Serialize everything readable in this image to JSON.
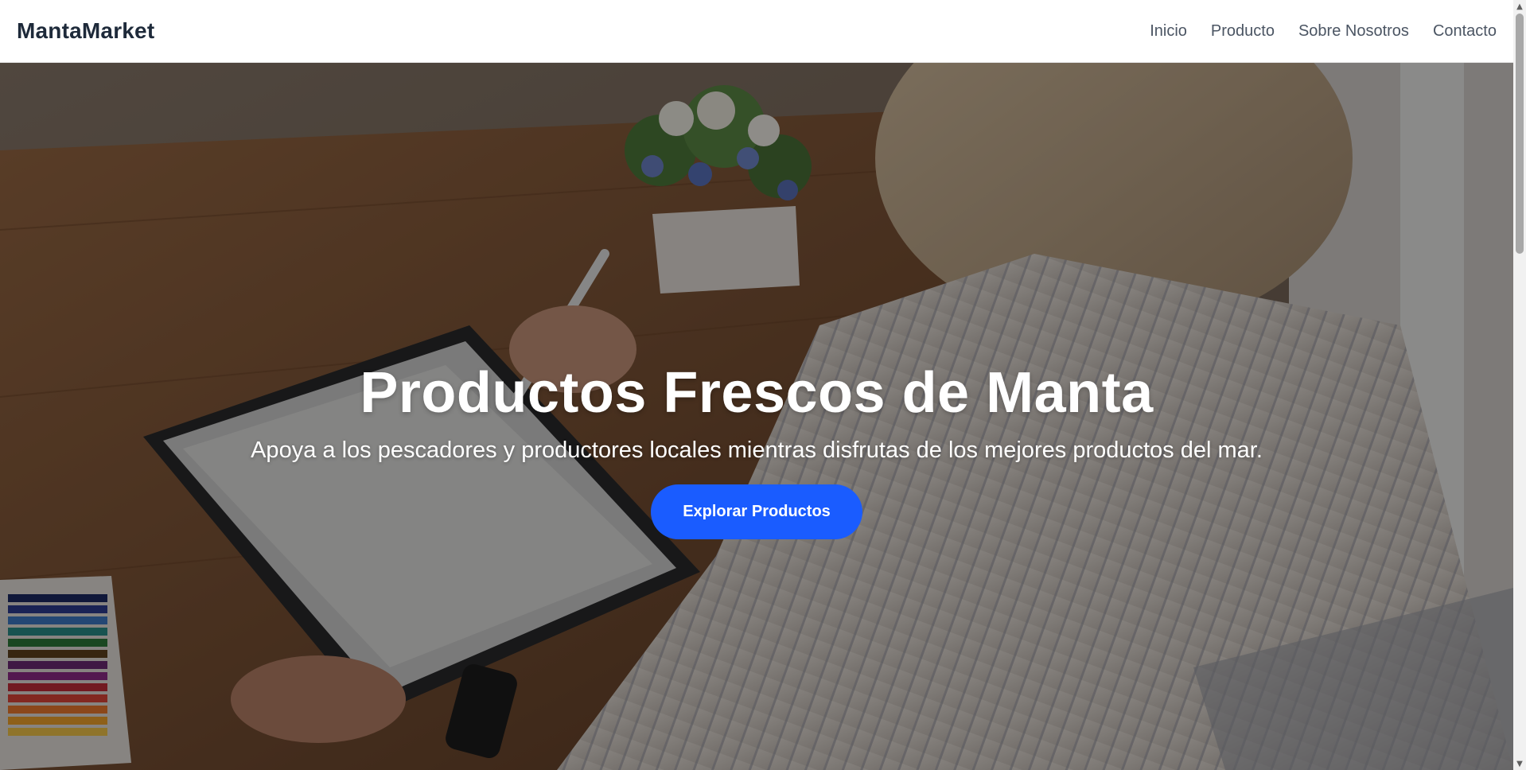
{
  "navbar": {
    "brand": "MantaMarket",
    "links": [
      "Inicio",
      "Producto",
      "Sobre Nosotros",
      "Contacto"
    ]
  },
  "hero": {
    "title": "Productos Frescos de Manta",
    "subtitle": "Apoya a los pescadores y productores locales mientras disfrutas de los mejores productos del mar.",
    "button_label": "Explorar Productos",
    "background_image": "person-drawing-on-tablet-at-wooden-desk-photo"
  },
  "colors": {
    "accent": "#1a5cff",
    "brand_text": "#1e2a3a",
    "nav_text": "#4b5563"
  },
  "icons": {
    "scroll_up": "triangle-up-icon",
    "scroll_down": "triangle-down-icon"
  }
}
